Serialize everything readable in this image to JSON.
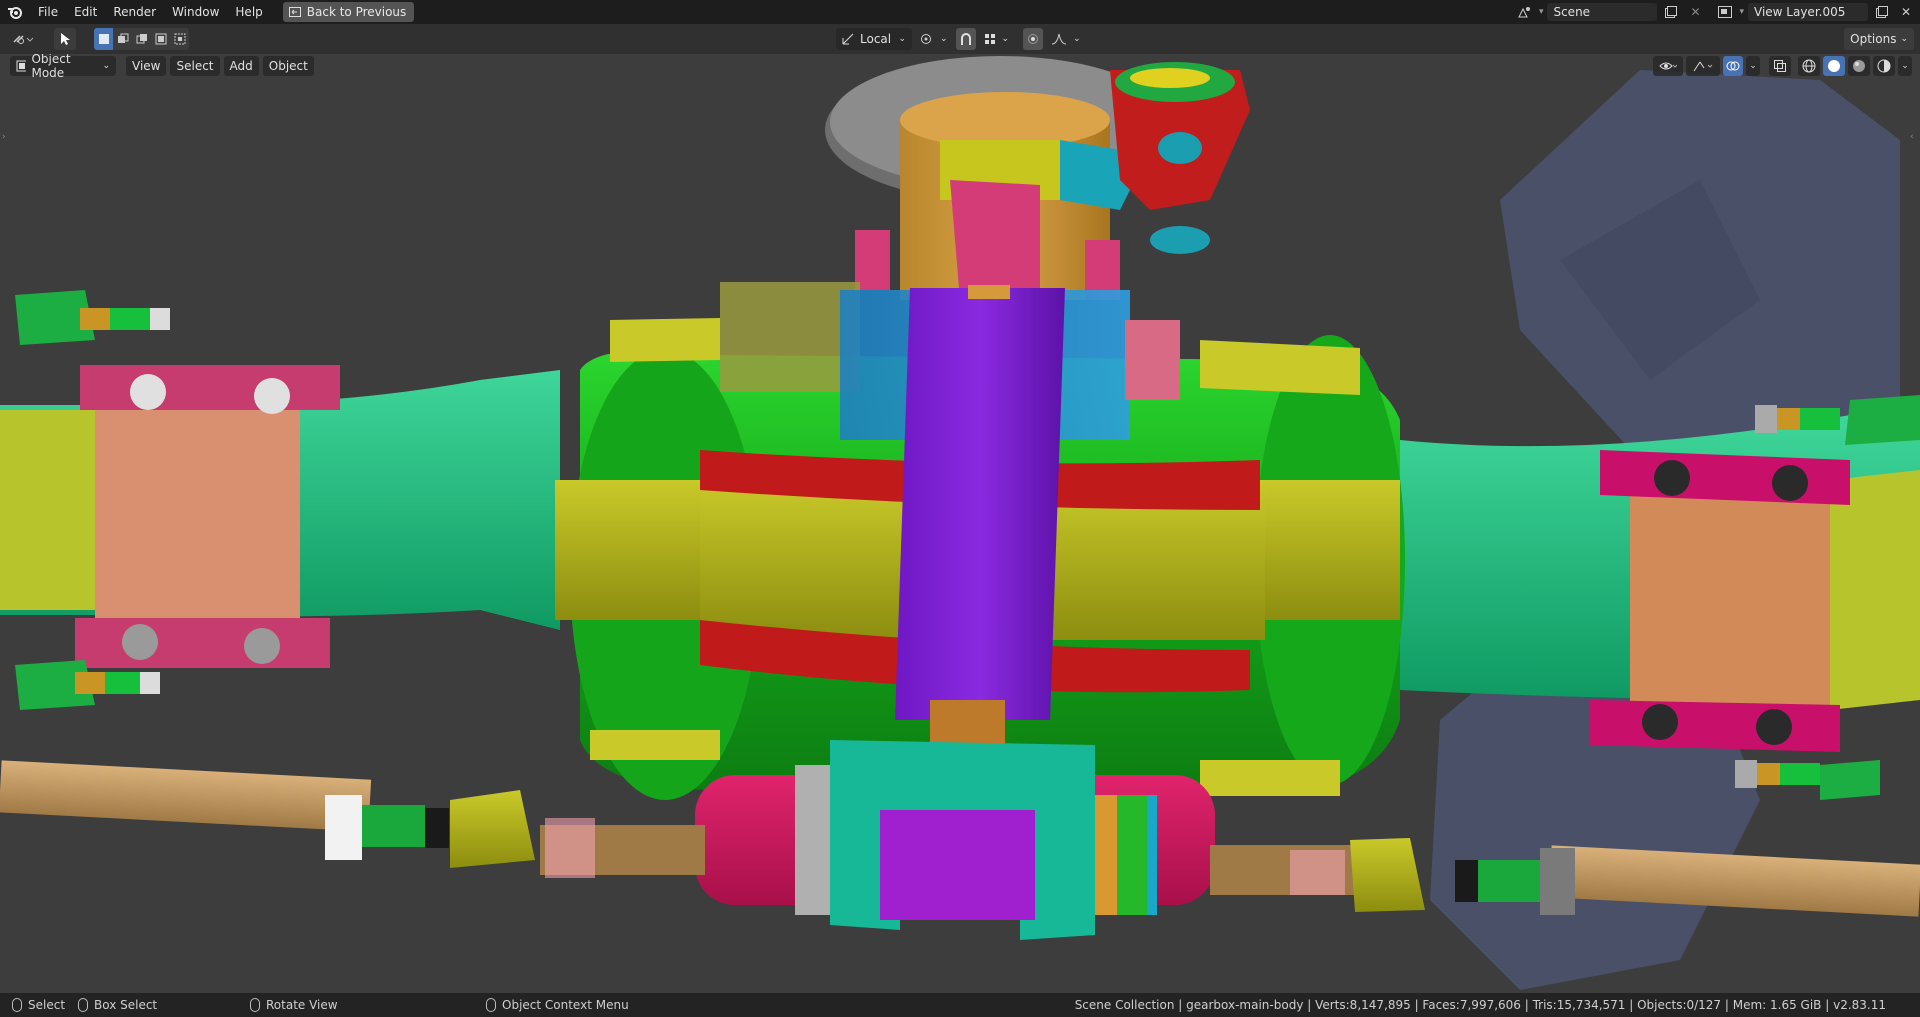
{
  "top_menu": {
    "items": [
      "File",
      "Edit",
      "Render",
      "Window",
      "Help"
    ],
    "back_button": "Back to Previous"
  },
  "top_right": {
    "scene_name": "Scene",
    "view_layer": "View Layer.005"
  },
  "toolrow": {
    "transform_orientation": "Local",
    "options_label": "Options"
  },
  "viewport_header": {
    "mode": "Object Mode",
    "menus": [
      "View",
      "Select",
      "Add",
      "Object"
    ]
  },
  "status_bar": {
    "select": "Select",
    "box_select": "Box Select",
    "rotate_view": "Rotate View",
    "context_menu": "Object Context Menu",
    "stats": "Scene Collection | gearbox-main-body | Verts:8,147,895 | Faces:7,997,606 | Tris:15,734,571 | Objects:0/127 | Mem: 1.65 GiB | v2.83.11"
  },
  "colors": {
    "accent": "#4772b3",
    "topbar": "#1d1d1d",
    "toolrow": "#303030",
    "viewport_bg": "#3d3d3d"
  }
}
